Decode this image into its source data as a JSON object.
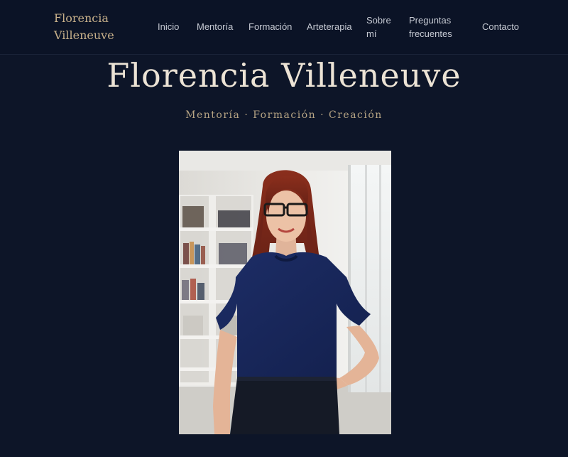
{
  "header": {
    "brand": {
      "line1": "Florencia",
      "line2": "Villeneuve"
    },
    "nav": [
      {
        "label": "Inicio"
      },
      {
        "label": "Mentoría"
      },
      {
        "label": "Formación"
      },
      {
        "label": "Arteterapia"
      },
      {
        "label_line1": "Sobre",
        "label_line2": "mí"
      },
      {
        "label_line1": "Preguntas",
        "label_line2": "frecuentes"
      },
      {
        "label": "Contacto"
      }
    ]
  },
  "hero": {
    "title": "Florencia Villeneuve",
    "subtitle": "Mentoría · Formación · Creación"
  },
  "colors": {
    "background": "#0d1528",
    "brand_gold": "#c7b08a",
    "title": "#ece3d5",
    "nav_text": "#c6cad3"
  }
}
